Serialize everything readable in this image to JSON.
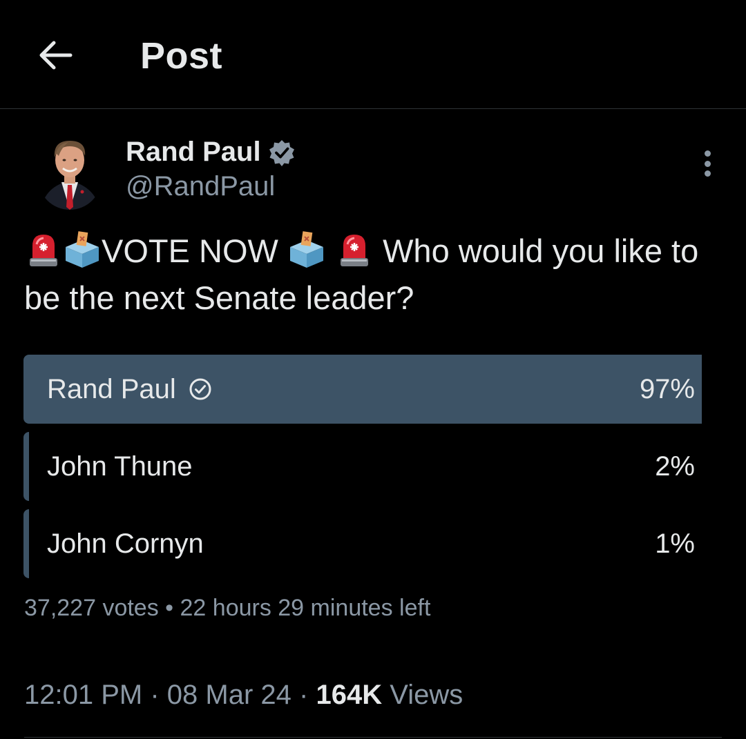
{
  "header": {
    "back_icon": "arrow-left-icon",
    "title": "Post"
  },
  "author": {
    "name": "Rand Paul",
    "handle": "@RandPaul",
    "verified_icon": "verified-badge-icon",
    "verified_color": "#8b98a5"
  },
  "tweet": {
    "prefix_emoji": [
      "police-light-emoji",
      "ballot-box-emoji"
    ],
    "text_part1": "VOTE NOW",
    "mid_emoji": [
      "ballot-box-emoji",
      "police-light-emoji"
    ],
    "text_part2": " Who would you like to be the next Senate leader?"
  },
  "poll": {
    "options": [
      {
        "label": "Rand Paul",
        "percent": "97%",
        "share": 0.97,
        "winner": true
      },
      {
        "label": "John Thune",
        "percent": "2%",
        "share": 0.02,
        "winner": false
      },
      {
        "label": "John Cornyn",
        "percent": "1%",
        "share": 0.01,
        "winner": false
      }
    ],
    "votes": "37,227 votes",
    "separator": "•",
    "time_left": "22 hours 29 minutes left",
    "bar_color": "#3d5366"
  },
  "meta": {
    "time": "12:01 PM",
    "sep1": "·",
    "date": "08 Mar 24",
    "sep2": "·",
    "views_count": "164K",
    "views_label": "Views"
  }
}
